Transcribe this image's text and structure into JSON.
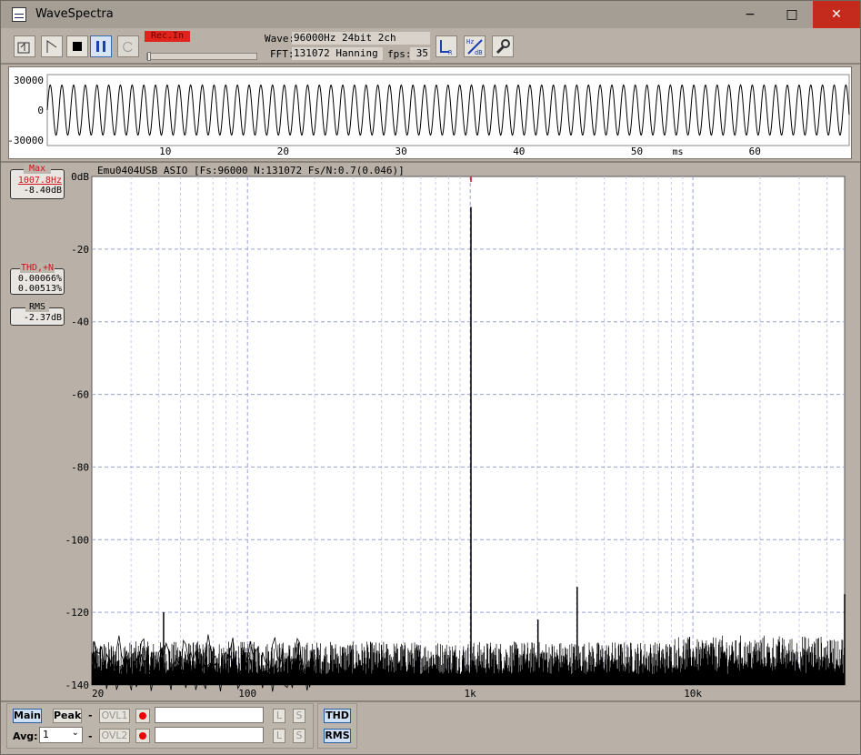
{
  "window": {
    "title": "WaveSpectra",
    "minimize": "−",
    "maximize": "□",
    "close": "✕"
  },
  "toolbar": {
    "rec_indicator": "Rec.In",
    "wave_label": "Wave:",
    "wave_value": "96000Hz 24bit 2ch",
    "fft_label": "FFT:",
    "fft_value": "131072 Hanning",
    "fps_label": "fps:",
    "fps_value": "35",
    "lr_icon_text": "L R",
    "hz_db_icon_text": "Hz dB"
  },
  "wave_view": {
    "y_labels": [
      "30000",
      "0",
      "-30000"
    ],
    "x_labels": [
      "10",
      "20",
      "30",
      "40",
      "50",
      "60"
    ],
    "x_unit": "ms"
  },
  "spectrum": {
    "header": "Emu0404USB ASIO  [Fs:96000 N:131072 Fs/N:0.7(0.046)]",
    "y_labels": [
      "0dB",
      "-20",
      "-40",
      "-60",
      "-80",
      "-100",
      "-120",
      "-140"
    ],
    "x_labels": [
      "20",
      "100",
      "1k",
      "10k"
    ]
  },
  "indicators": {
    "max_label": "Max",
    "max_freq": "1007.8Hz",
    "max_level": "-8.40dB",
    "thd_label": "THD,+N",
    "thd_value": "0.00066%",
    "thdn_value": "0.00513%",
    "rms_label": "RMS",
    "rms_value": "-2.37dB"
  },
  "bottom": {
    "main_button": "Main",
    "peak_button": "Peak",
    "dash1": "-",
    "dash2": "-",
    "ovl1": "OVL1",
    "ovl2": "OVL2",
    "avg_label": "Avg:",
    "avg_value": "1",
    "l1": "L",
    "s1": "S",
    "l2": "L",
    "s2": "S",
    "thd_button": "THD",
    "rms_button": "RMS"
  },
  "chart_data": [
    {
      "type": "line",
      "title": "",
      "xlabel": "ms",
      "ylabel": "",
      "xlim": [
        0,
        68
      ],
      "ylim": [
        -30000,
        30000
      ],
      "series": [
        {
          "frequency_hz": 1007.8,
          "amplitude": 25000
        }
      ]
    },
    {
      "type": "line",
      "title": "Emu0404USB ASIO  [Fs:96000 N:131072 Fs/N:0.7(0.046)]",
      "x_scale": "log",
      "xlim": [
        20,
        48000
      ],
      "ylim": [
        -140,
        0
      ],
      "x_ticks": [
        20,
        100,
        1000,
        10000
      ],
      "y_ticks": [
        0,
        -20,
        -40,
        -60,
        -80,
        -100,
        -120,
        -140
      ],
      "peaks": [
        {
          "x": 1007.8,
          "y": -8.4
        },
        {
          "x": 2015,
          "y": -122
        },
        {
          "x": 3023,
          "y": -113
        },
        {
          "x": 48000,
          "y": -115
        },
        {
          "x": 42,
          "y": -120
        }
      ],
      "noise_floor": [
        -140,
        -128
      ]
    }
  ]
}
